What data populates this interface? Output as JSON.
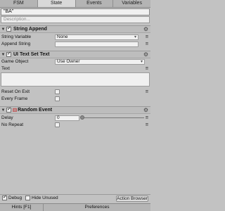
{
  "tabs": [
    "FSM",
    "State",
    "Events",
    "Variables"
  ],
  "active_tab": "State",
  "state_name": "\"BA\"",
  "description_placeholder": "Description...",
  "actions": [
    {
      "title": "String Append",
      "enabled": true,
      "props": [
        {
          "label": "String Variable",
          "value": "None"
        },
        {
          "label": "Append String",
          "value": ""
        }
      ]
    },
    {
      "title": "UI Text Set Text",
      "enabled": true,
      "props": [
        {
          "label": "Game Object",
          "value": "Use Owner"
        },
        {
          "label": "Text",
          "value": ""
        },
        {
          "label": "Reset On Exit",
          "value": ""
        },
        {
          "label": "Every Frame",
          "value": ""
        }
      ]
    },
    {
      "title": "Random Event",
      "enabled": true,
      "props": [
        {
          "label": "Delay",
          "value": "0"
        },
        {
          "label": "No Repeat",
          "value": ""
        }
      ]
    }
  ],
  "bottom": {
    "debug_label": "Debug",
    "hide_unused_label": "Hide Unused",
    "action_browser_label": "Action Browser"
  },
  "footer": {
    "hints_label": "Hints [F1]",
    "preferences_label": "Preferences"
  },
  "icons": {
    "settings": "gear-icon",
    "fold": "triangle-down-icon",
    "random_event": "dice-icon"
  }
}
